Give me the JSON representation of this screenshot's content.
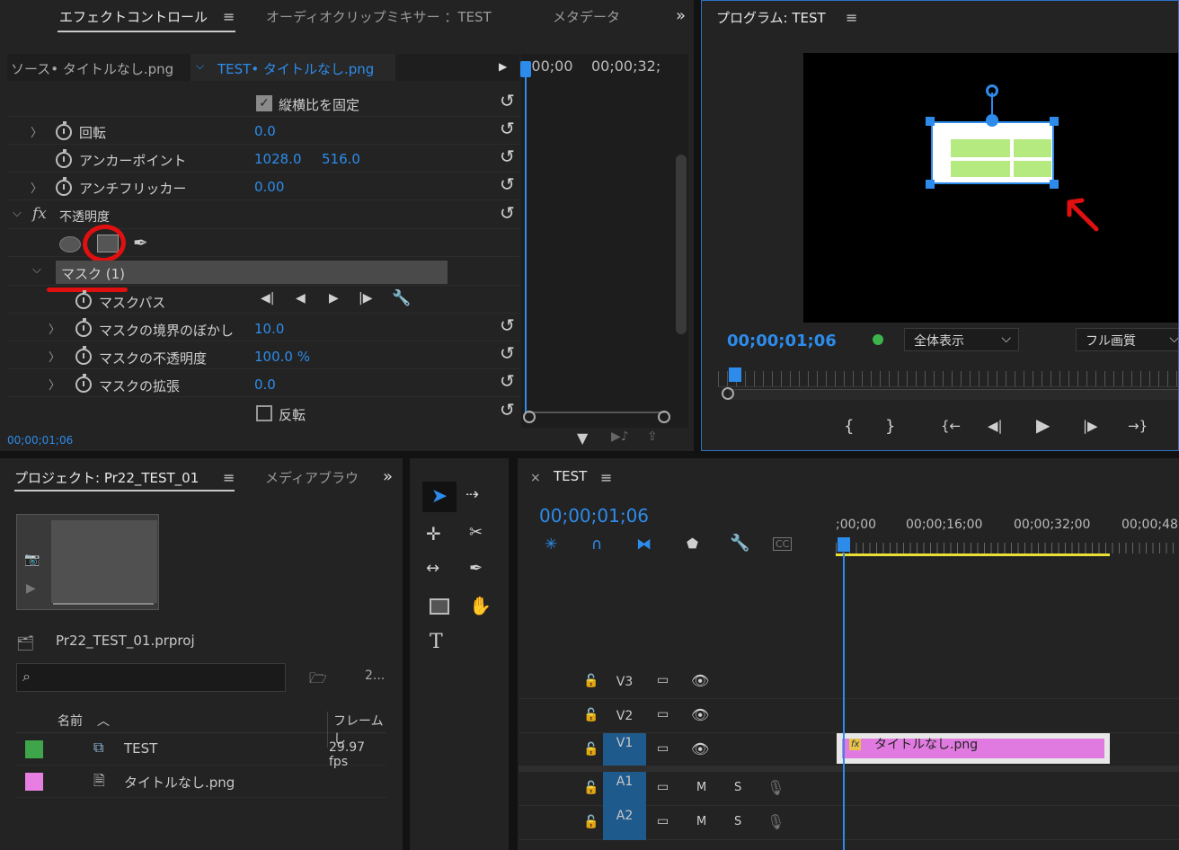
{
  "effect_panel": {
    "tabs": [
      "エフェクトコントロール",
      "オーディオクリップミキサー ：TEST",
      "メタデータ"
    ],
    "menu_icon": "≡",
    "overflow": "»",
    "source": "ソース• タイトルなし.png",
    "clip": "TEST• タイトルなし.png",
    "tl_time_a": ";00;00",
    "tl_time_b": "00;00;32;",
    "lock_ratio": "縦横比を固定",
    "rotate_label": "回転",
    "rotate_val": "0.0",
    "anchor_label": "アンカーポイント",
    "anchor_x": "1028.0",
    "anchor_y": "516.0",
    "flicker_label": "アンチフリッカー",
    "flicker_val": "0.00",
    "fx": "fx",
    "opacity_label": "不透明度",
    "mask_label": "マスク (1)",
    "mask_path": "マスクパス",
    "feather_label": "マスクの境界のぼかし",
    "feather_val": "10.0",
    "mask_opacity_label": "マスクの不透明度",
    "mask_opacity_val": "100.0 %",
    "expand_label": "マスクの拡張",
    "expand_val": "0.0",
    "invert_label": "反転",
    "timecode": "00;00;01;06"
  },
  "program": {
    "title": "プログラム: TEST",
    "timecode": "00;00;01;06",
    "zoom": "全体表示",
    "quality": "フル画質",
    "transport": [
      "{",
      "}",
      "{←",
      "◀|",
      "▶",
      "|▶",
      "→}"
    ]
  },
  "project": {
    "title": "プロジェクト: Pr22_TEST_01",
    "media_tab": "メディアブラウ",
    "file": "Pr22_TEST_01.prproj",
    "count": "2...",
    "col_name": "名前",
    "col_frame": "フレームし",
    "items": [
      {
        "name": "TEST",
        "rate": "29.97 fps",
        "color": "#3fa54a"
      },
      {
        "name": "タイトルなし.png",
        "rate": "",
        "color": "#e77fe2"
      }
    ]
  },
  "timeline": {
    "close": "×",
    "title": "TEST",
    "timecode": "00;00;01;06",
    "ruler": [
      ";00;00",
      "00;00;16;00",
      "00;00;32;00",
      "00;00;48"
    ],
    "clip": "タイトルなし.png",
    "tracks": [
      "V3",
      "V2",
      "V1",
      "A1",
      "A2"
    ],
    "m": "M",
    "s": "S",
    "cc": "CC"
  },
  "colors": {
    "accent": "#2d8ceb",
    "clip": "#e17ae0",
    "work": "#e8e035",
    "annot": "#e01010"
  }
}
